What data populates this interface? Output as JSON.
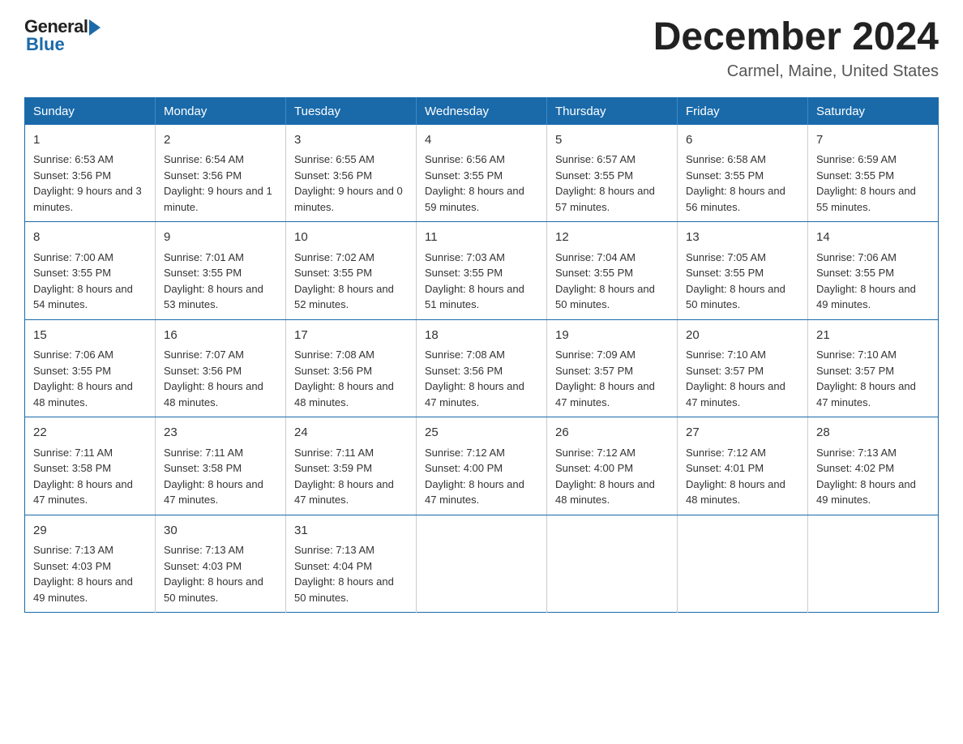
{
  "header": {
    "logo_general": "General",
    "logo_blue": "Blue",
    "month_title": "December 2024",
    "location": "Carmel, Maine, United States"
  },
  "weekdays": [
    "Sunday",
    "Monday",
    "Tuesday",
    "Wednesday",
    "Thursday",
    "Friday",
    "Saturday"
  ],
  "weeks": [
    [
      {
        "day": "1",
        "sunrise": "6:53 AM",
        "sunset": "3:56 PM",
        "daylight": "9 hours and 3 minutes."
      },
      {
        "day": "2",
        "sunrise": "6:54 AM",
        "sunset": "3:56 PM",
        "daylight": "9 hours and 1 minute."
      },
      {
        "day": "3",
        "sunrise": "6:55 AM",
        "sunset": "3:56 PM",
        "daylight": "9 hours and 0 minutes."
      },
      {
        "day": "4",
        "sunrise": "6:56 AM",
        "sunset": "3:55 PM",
        "daylight": "8 hours and 59 minutes."
      },
      {
        "day": "5",
        "sunrise": "6:57 AM",
        "sunset": "3:55 PM",
        "daylight": "8 hours and 57 minutes."
      },
      {
        "day": "6",
        "sunrise": "6:58 AM",
        "sunset": "3:55 PM",
        "daylight": "8 hours and 56 minutes."
      },
      {
        "day": "7",
        "sunrise": "6:59 AM",
        "sunset": "3:55 PM",
        "daylight": "8 hours and 55 minutes."
      }
    ],
    [
      {
        "day": "8",
        "sunrise": "7:00 AM",
        "sunset": "3:55 PM",
        "daylight": "8 hours and 54 minutes."
      },
      {
        "day": "9",
        "sunrise": "7:01 AM",
        "sunset": "3:55 PM",
        "daylight": "8 hours and 53 minutes."
      },
      {
        "day": "10",
        "sunrise": "7:02 AM",
        "sunset": "3:55 PM",
        "daylight": "8 hours and 52 minutes."
      },
      {
        "day": "11",
        "sunrise": "7:03 AM",
        "sunset": "3:55 PM",
        "daylight": "8 hours and 51 minutes."
      },
      {
        "day": "12",
        "sunrise": "7:04 AM",
        "sunset": "3:55 PM",
        "daylight": "8 hours and 50 minutes."
      },
      {
        "day": "13",
        "sunrise": "7:05 AM",
        "sunset": "3:55 PM",
        "daylight": "8 hours and 50 minutes."
      },
      {
        "day": "14",
        "sunrise": "7:06 AM",
        "sunset": "3:55 PM",
        "daylight": "8 hours and 49 minutes."
      }
    ],
    [
      {
        "day": "15",
        "sunrise": "7:06 AM",
        "sunset": "3:55 PM",
        "daylight": "8 hours and 48 minutes."
      },
      {
        "day": "16",
        "sunrise": "7:07 AM",
        "sunset": "3:56 PM",
        "daylight": "8 hours and 48 minutes."
      },
      {
        "day": "17",
        "sunrise": "7:08 AM",
        "sunset": "3:56 PM",
        "daylight": "8 hours and 48 minutes."
      },
      {
        "day": "18",
        "sunrise": "7:08 AM",
        "sunset": "3:56 PM",
        "daylight": "8 hours and 47 minutes."
      },
      {
        "day": "19",
        "sunrise": "7:09 AM",
        "sunset": "3:57 PM",
        "daylight": "8 hours and 47 minutes."
      },
      {
        "day": "20",
        "sunrise": "7:10 AM",
        "sunset": "3:57 PM",
        "daylight": "8 hours and 47 minutes."
      },
      {
        "day": "21",
        "sunrise": "7:10 AM",
        "sunset": "3:57 PM",
        "daylight": "8 hours and 47 minutes."
      }
    ],
    [
      {
        "day": "22",
        "sunrise": "7:11 AM",
        "sunset": "3:58 PM",
        "daylight": "8 hours and 47 minutes."
      },
      {
        "day": "23",
        "sunrise": "7:11 AM",
        "sunset": "3:58 PM",
        "daylight": "8 hours and 47 minutes."
      },
      {
        "day": "24",
        "sunrise": "7:11 AM",
        "sunset": "3:59 PM",
        "daylight": "8 hours and 47 minutes."
      },
      {
        "day": "25",
        "sunrise": "7:12 AM",
        "sunset": "4:00 PM",
        "daylight": "8 hours and 47 minutes."
      },
      {
        "day": "26",
        "sunrise": "7:12 AM",
        "sunset": "4:00 PM",
        "daylight": "8 hours and 48 minutes."
      },
      {
        "day": "27",
        "sunrise": "7:12 AM",
        "sunset": "4:01 PM",
        "daylight": "8 hours and 48 minutes."
      },
      {
        "day": "28",
        "sunrise": "7:13 AM",
        "sunset": "4:02 PM",
        "daylight": "8 hours and 49 minutes."
      }
    ],
    [
      {
        "day": "29",
        "sunrise": "7:13 AM",
        "sunset": "4:03 PM",
        "daylight": "8 hours and 49 minutes."
      },
      {
        "day": "30",
        "sunrise": "7:13 AM",
        "sunset": "4:03 PM",
        "daylight": "8 hours and 50 minutes."
      },
      {
        "day": "31",
        "sunrise": "7:13 AM",
        "sunset": "4:04 PM",
        "daylight": "8 hours and 50 minutes."
      },
      null,
      null,
      null,
      null
    ]
  ],
  "labels": {
    "sunrise": "Sunrise:",
    "sunset": "Sunset:",
    "daylight": "Daylight:"
  }
}
